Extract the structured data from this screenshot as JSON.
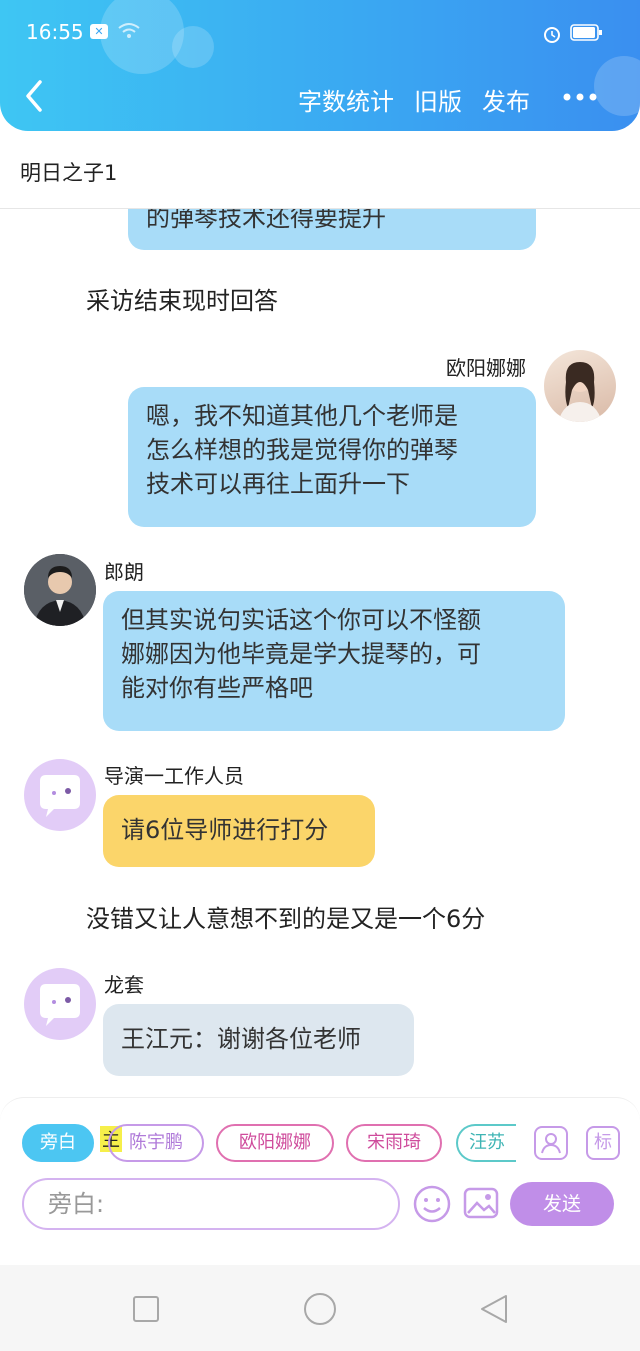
{
  "status_bar": {
    "time": "16:55"
  },
  "header": {
    "actions": [
      "字数统计",
      "旧版",
      "发布"
    ]
  },
  "document": {
    "title": "明日之子1"
  },
  "messages": {
    "partial_top": "的弹琴技术还得要提升",
    "narration_1": "采访结束现时回答",
    "msg_1": {
      "speaker": "欧阳娜娜",
      "lines": [
        "嗯，我不知道其他几个老师是",
        "怎么样想的我是觉得你的弹琴",
        "技术可以再往上面升一下"
      ]
    },
    "msg_2": {
      "speaker": "郎朗",
      "lines": [
        "但其实说句实话这个你可以不怪额",
        "娜娜因为他毕竟是学大提琴的，可",
        "能对你有些严格吧"
      ]
    },
    "msg_3": {
      "speaker": "导演一工作人员",
      "text": "请6位导师进行打分"
    },
    "narration_2": "没错又让人意想不到的是又是一个6分",
    "msg_4": {
      "speaker": "龙套",
      "text": "王江元：谢谢各位老师"
    }
  },
  "composer": {
    "chips": [
      "旁白",
      "陈宇鹏",
      "欧阳娜娜",
      "宋雨琦",
      "汪苏"
    ],
    "main_tag": "主",
    "mark_label": "标",
    "input_value": "旁白:",
    "send_label": "发送"
  },
  "colors": {
    "header": "#3aa6f2",
    "bubble_blue": "#a8dcf8",
    "bubble_yellow": "#fbd56a",
    "bubble_grey": "#dde7ef",
    "send": "#c08ee8"
  }
}
